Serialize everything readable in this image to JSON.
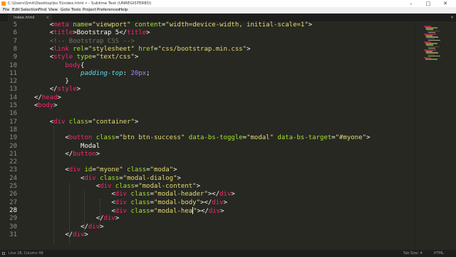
{
  "window": {
    "title": "C:\\Users\\Smit\\Desktop\\bs 5\\index.html • - Sublime Text (UNREGISTERED)",
    "controls": [
      "–",
      "□",
      "✕"
    ]
  },
  "menu": [
    "File",
    "Edit",
    "Selection",
    "Find",
    "View",
    "Goto",
    "Tools",
    "Project",
    "Preferences",
    "Help"
  ],
  "tab": {
    "label": "index.html",
    "close": "×",
    "overflow": "▾"
  },
  "editor": {
    "active_line": 28,
    "lines": [
      {
        "n": "5",
        "segs": [
          {
            "t": "    "
          },
          {
            "t": "<",
            "c": "t-pl"
          },
          {
            "t": "meta",
            "c": "t-tag"
          },
          {
            "t": " name",
            "c": "t-attr"
          },
          {
            "t": "=",
            "c": "t-pl"
          },
          {
            "t": "\"viewport\"",
            "c": "t-str"
          },
          {
            "t": " content",
            "c": "t-attr"
          },
          {
            "t": "=",
            "c": "t-pl"
          },
          {
            "t": "\"width=device-width, initial-scale=1\"",
            "c": "t-str"
          },
          {
            "t": ">",
            "c": "t-pl"
          }
        ]
      },
      {
        "n": "6",
        "segs": [
          {
            "t": "    "
          },
          {
            "t": "<",
            "c": "t-pl"
          },
          {
            "t": "title",
            "c": "t-tag"
          },
          {
            "t": ">",
            "c": "t-pl"
          },
          {
            "t": "Bootstrap 5",
            "c": "t-pl"
          },
          {
            "t": "</",
            "c": "t-pl"
          },
          {
            "t": "title",
            "c": "t-tag"
          },
          {
            "t": ">",
            "c": "t-pl"
          }
        ]
      },
      {
        "n": "7",
        "segs": [
          {
            "t": "    "
          },
          {
            "t": "<!-- Bootstrap CSS -->",
            "c": "t-com"
          }
        ]
      },
      {
        "n": "8",
        "segs": [
          {
            "t": "    "
          },
          {
            "t": "<",
            "c": "t-pl"
          },
          {
            "t": "link",
            "c": "t-tag"
          },
          {
            "t": " rel",
            "c": "t-attr"
          },
          {
            "t": "=",
            "c": "t-pl"
          },
          {
            "t": "\"stylesheet\"",
            "c": "t-str"
          },
          {
            "t": " href",
            "c": "t-attr"
          },
          {
            "t": "=",
            "c": "t-pl"
          },
          {
            "t": "\"css/bootstrap.min.css\"",
            "c": "t-str"
          },
          {
            "t": ">",
            "c": "t-pl"
          }
        ]
      },
      {
        "n": "9",
        "segs": [
          {
            "t": "    "
          },
          {
            "t": "<",
            "c": "t-pl"
          },
          {
            "t": "style",
            "c": "t-tag"
          },
          {
            "t": " type",
            "c": "t-attr"
          },
          {
            "t": "=",
            "c": "t-pl"
          },
          {
            "t": "\"text/css\"",
            "c": "t-str"
          },
          {
            "t": ">",
            "c": "t-pl"
          }
        ]
      },
      {
        "n": "10",
        "segs": [
          {
            "t": "        "
          },
          {
            "t": "body",
            "c": "t-tag"
          },
          {
            "t": "{",
            "c": "t-pl"
          }
        ]
      },
      {
        "n": "11",
        "segs": [
          {
            "t": "            "
          },
          {
            "t": "padding-top",
            "c": "t-prop"
          },
          {
            "t": ": ",
            "c": "t-pl"
          },
          {
            "t": "20px",
            "c": "t-num"
          },
          {
            "t": ";",
            "c": "t-pl"
          }
        ]
      },
      {
        "n": "12",
        "segs": [
          {
            "t": "        "
          },
          {
            "t": "}",
            "c": "t-pl"
          }
        ]
      },
      {
        "n": "13",
        "segs": [
          {
            "t": "    "
          },
          {
            "t": "</",
            "c": "t-pl"
          },
          {
            "t": "style",
            "c": "t-tag"
          },
          {
            "t": ">",
            "c": "t-pl"
          }
        ]
      },
      {
        "n": "14",
        "segs": [
          {
            "t": "</",
            "c": "t-pl"
          },
          {
            "t": "head",
            "c": "t-tag"
          },
          {
            "t": ">",
            "c": "t-pl"
          }
        ]
      },
      {
        "n": "15",
        "segs": [
          {
            "t": "<",
            "c": "t-pl"
          },
          {
            "t": "body",
            "c": "t-tag"
          },
          {
            "t": ">",
            "c": "t-pl"
          }
        ]
      },
      {
        "n": "16",
        "segs": []
      },
      {
        "n": "17",
        "segs": [
          {
            "t": "    "
          },
          {
            "t": "<",
            "c": "t-pl"
          },
          {
            "t": "div",
            "c": "t-tag"
          },
          {
            "t": " class",
            "c": "t-attr"
          },
          {
            "t": "=",
            "c": "t-pl"
          },
          {
            "t": "\"container\"",
            "c": "t-str"
          },
          {
            "t": ">",
            "c": "t-pl"
          }
        ]
      },
      {
        "n": "18",
        "segs": []
      },
      {
        "n": "19",
        "segs": [
          {
            "t": "        "
          },
          {
            "t": "<",
            "c": "t-pl"
          },
          {
            "t": "button",
            "c": "t-tag"
          },
          {
            "t": " class",
            "c": "t-attr"
          },
          {
            "t": "=",
            "c": "t-pl"
          },
          {
            "t": "\"btn btn-success\"",
            "c": "t-str"
          },
          {
            "t": " data-bs-toggle",
            "c": "t-attr"
          },
          {
            "t": "=",
            "c": "t-pl"
          },
          {
            "t": "\"modal\"",
            "c": "t-str"
          },
          {
            "t": " data-bs-target",
            "c": "t-attr"
          },
          {
            "t": "=",
            "c": "t-pl"
          },
          {
            "t": "\"#myone\"",
            "c": "t-str"
          },
          {
            "t": ">",
            "c": "t-pl"
          }
        ]
      },
      {
        "n": "20",
        "segs": [
          {
            "t": "            "
          },
          {
            "t": "Modal",
            "c": "t-pl"
          }
        ]
      },
      {
        "n": "21",
        "segs": [
          {
            "t": "        "
          },
          {
            "t": "</",
            "c": "t-pl"
          },
          {
            "t": "button",
            "c": "t-tag"
          },
          {
            "t": ">",
            "c": "t-pl"
          }
        ]
      },
      {
        "n": "22",
        "segs": []
      },
      {
        "n": "23",
        "segs": [
          {
            "t": "        "
          },
          {
            "t": "<",
            "c": "t-pl"
          },
          {
            "t": "div",
            "c": "t-tag"
          },
          {
            "t": " id",
            "c": "t-attr"
          },
          {
            "t": "=",
            "c": "t-pl"
          },
          {
            "t": "\"myone\"",
            "c": "t-str"
          },
          {
            "t": " class",
            "c": "t-attr"
          },
          {
            "t": "=",
            "c": "t-pl"
          },
          {
            "t": "\"moda\"",
            "c": "t-str"
          },
          {
            "t": ">",
            "c": "t-pl"
          }
        ]
      },
      {
        "n": "24",
        "segs": [
          {
            "t": "            "
          },
          {
            "t": "<",
            "c": "t-pl"
          },
          {
            "t": "div",
            "c": "t-tag"
          },
          {
            "t": " class",
            "c": "t-attr"
          },
          {
            "t": "=",
            "c": "t-pl"
          },
          {
            "t": "\"modal-dialog\"",
            "c": "t-str"
          },
          {
            "t": ">",
            "c": "t-pl"
          }
        ]
      },
      {
        "n": "25",
        "segs": [
          {
            "t": "                "
          },
          {
            "t": "<",
            "c": "t-pl"
          },
          {
            "t": "div",
            "c": "t-tag"
          },
          {
            "t": " class",
            "c": "t-attr"
          },
          {
            "t": "=",
            "c": "t-pl"
          },
          {
            "t": "\"modal-content\"",
            "c": "t-str"
          },
          {
            "t": ">",
            "c": "t-pl"
          }
        ]
      },
      {
        "n": "26",
        "segs": [
          {
            "t": "                    "
          },
          {
            "t": "<",
            "c": "t-pl"
          },
          {
            "t": "div",
            "c": "t-tag"
          },
          {
            "t": " class",
            "c": "t-attr"
          },
          {
            "t": "=",
            "c": "t-pl"
          },
          {
            "t": "\"modal-header\"",
            "c": "t-str"
          },
          {
            "t": "></",
            "c": "t-pl"
          },
          {
            "t": "div",
            "c": "t-tag"
          },
          {
            "t": ">",
            "c": "t-pl"
          }
        ]
      },
      {
        "n": "27",
        "segs": [
          {
            "t": "                    "
          },
          {
            "t": "<",
            "c": "t-pl"
          },
          {
            "t": "div",
            "c": "t-tag"
          },
          {
            "t": " class",
            "c": "t-attr"
          },
          {
            "t": "=",
            "c": "t-pl"
          },
          {
            "t": "\"modal-body\"",
            "c": "t-str"
          },
          {
            "t": "></",
            "c": "t-pl"
          },
          {
            "t": "div",
            "c": "t-tag"
          },
          {
            "t": ">",
            "c": "t-pl"
          }
        ]
      },
      {
        "n": "28",
        "segs": [
          {
            "t": "                    "
          },
          {
            "t": "<",
            "c": "t-pl"
          },
          {
            "t": "div",
            "c": "t-tag"
          },
          {
            "t": " class",
            "c": "t-attr"
          },
          {
            "t": "=",
            "c": "t-pl"
          },
          {
            "t": "\"modal-hea",
            "c": "t-str"
          },
          {
            "caret": true
          },
          {
            "t": "\"",
            "c": "t-str"
          },
          {
            "t": "></",
            "c": "t-pl"
          },
          {
            "t": "div",
            "c": "t-tag"
          },
          {
            "t": ">",
            "c": "t-pl"
          }
        ]
      },
      {
        "n": "29",
        "segs": [
          {
            "t": "                "
          },
          {
            "t": "</",
            "c": "t-pl"
          },
          {
            "t": "div",
            "c": "t-tag"
          },
          {
            "t": ">",
            "c": "t-pl"
          }
        ]
      },
      {
        "n": "30",
        "segs": [
          {
            "t": "            "
          },
          {
            "t": "</",
            "c": "t-pl"
          },
          {
            "t": "div",
            "c": "t-tag"
          },
          {
            "t": ">",
            "c": "t-pl"
          }
        ]
      },
      {
        "n": "31",
        "segs": [
          {
            "t": "        "
          },
          {
            "t": "</",
            "c": "t-pl"
          },
          {
            "t": "div",
            "c": "t-tag"
          },
          {
            "t": ">",
            "c": "t-pl"
          }
        ]
      }
    ]
  },
  "status": {
    "position": "Line 28, Column 48",
    "tab_size": "Tab Size: 4",
    "syntax": "HTML"
  },
  "colors": {
    "background": "#272822",
    "tag": "#f92672",
    "attr": "#a6e22e",
    "string": "#e6db74",
    "comment": "#75715e"
  }
}
